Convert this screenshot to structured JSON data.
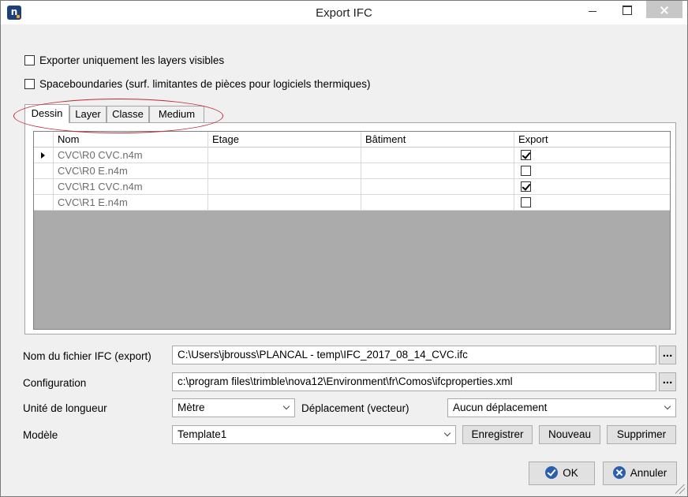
{
  "window": {
    "title": "Export IFC",
    "app_icon_letter": "n"
  },
  "options": {
    "visible_layers_label": "Exporter uniquement les layers visibles",
    "visible_layers_checked": false,
    "spaceboundaries_label": "Spaceboundaries (surf. limitantes  de pièces pour logiciels thermiques)",
    "spaceboundaries_checked": false
  },
  "tabs": [
    {
      "label": "Dessin",
      "active": true
    },
    {
      "label": "Layer",
      "active": false
    },
    {
      "label": "Classe",
      "active": false
    },
    {
      "label": "Medium",
      "active": false
    }
  ],
  "grid": {
    "columns": [
      "Nom",
      "Etage",
      "Bâtiment",
      "Export"
    ],
    "rows": [
      {
        "nom": "CVC\\R0 CVC.n4m",
        "etage": "",
        "batiment": "",
        "export": true,
        "current": true
      },
      {
        "nom": "CVC\\R0 E.n4m",
        "etage": "",
        "batiment": "",
        "export": false,
        "current": false
      },
      {
        "nom": "CVC\\R1 CVC.n4m",
        "etage": "",
        "batiment": "",
        "export": true,
        "current": false
      },
      {
        "nom": "CVC\\R1 E.n4m",
        "etage": "",
        "batiment": "",
        "export": false,
        "current": false
      }
    ]
  },
  "form": {
    "ifc_file_label": "Nom du fichier IFC (export)",
    "ifc_file_value": "C:\\Users\\jbrouss\\PLANCAL - temp\\IFC_2017_08_14_CVC.ifc",
    "configuration_label": "Configuration",
    "configuration_value": "c:\\program files\\trimble\\nova12\\Environment\\fr\\Comos\\ifcproperties.xml",
    "browse_label": "...",
    "length_unit_label": "Unité de longueur",
    "length_unit_value": "Mètre",
    "displacement_label": "Déplacement (vecteur)",
    "displacement_value": "Aucun déplacement",
    "model_label": "Modèle",
    "model_value": "Template1",
    "save_label": "Enregistrer",
    "new_label": "Nouveau",
    "delete_label": "Supprimer"
  },
  "footer": {
    "ok_label": "OK",
    "cancel_label": "Annuler"
  },
  "colors": {
    "annotation_ellipse": "#c0282e",
    "icon_blue": "#2b5fae",
    "grid_empty": "#ababab"
  }
}
